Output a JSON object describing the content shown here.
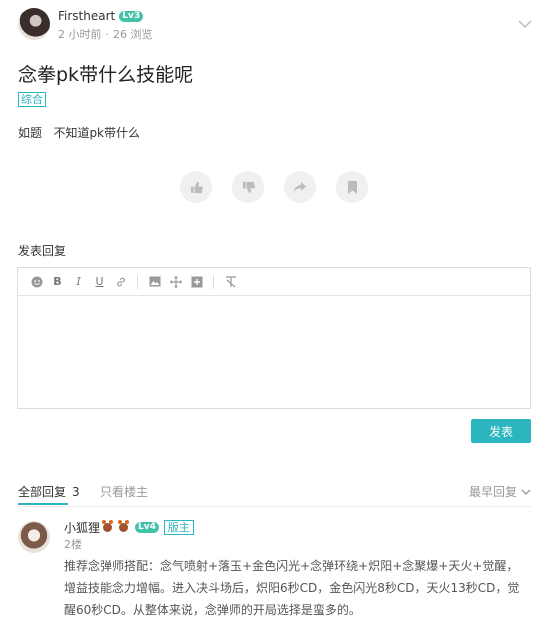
{
  "post": {
    "author": "Firstheart",
    "level": "Lv3",
    "time": "2 小时前",
    "views": "26 浏览",
    "title": "念拳pk带什么技能呢",
    "tag": "综合",
    "content": "如题   不知道pk带什么"
  },
  "actions": {
    "icons": [
      "thumb-up-icon",
      "thumb-down-icon",
      "share-icon",
      "bookmark-icon"
    ]
  },
  "reply_form": {
    "label": "发表回复",
    "submit": "发表",
    "toolbar_icons": [
      "emoji",
      "bold",
      "italic",
      "underline",
      "link",
      "image",
      "move",
      "insert",
      "clear-format"
    ]
  },
  "tabs": {
    "all_label": "全部回复",
    "all_count": "3",
    "owner_only": "只看楼主",
    "sort": "最早回复"
  },
  "replies": [
    {
      "author": "小狐狸",
      "level": "Lv4",
      "badge": "版主",
      "floor": "2楼",
      "text": "推荐念弹师搭配：念气喷射+落玉+金色闪光+念弹环绕+炽阳+念聚爆+天火+觉醒，增益技能念力增幅。进入决斗场后，炽阳6秒CD，金色闪光8秒CD，天火13秒CD，觉醒60秒CD。从整体来说，念弹师的开局选择是蛮多的。"
    }
  ],
  "colors": {
    "accent": "#2ab5bf",
    "level_badge": "#43c2a9"
  }
}
